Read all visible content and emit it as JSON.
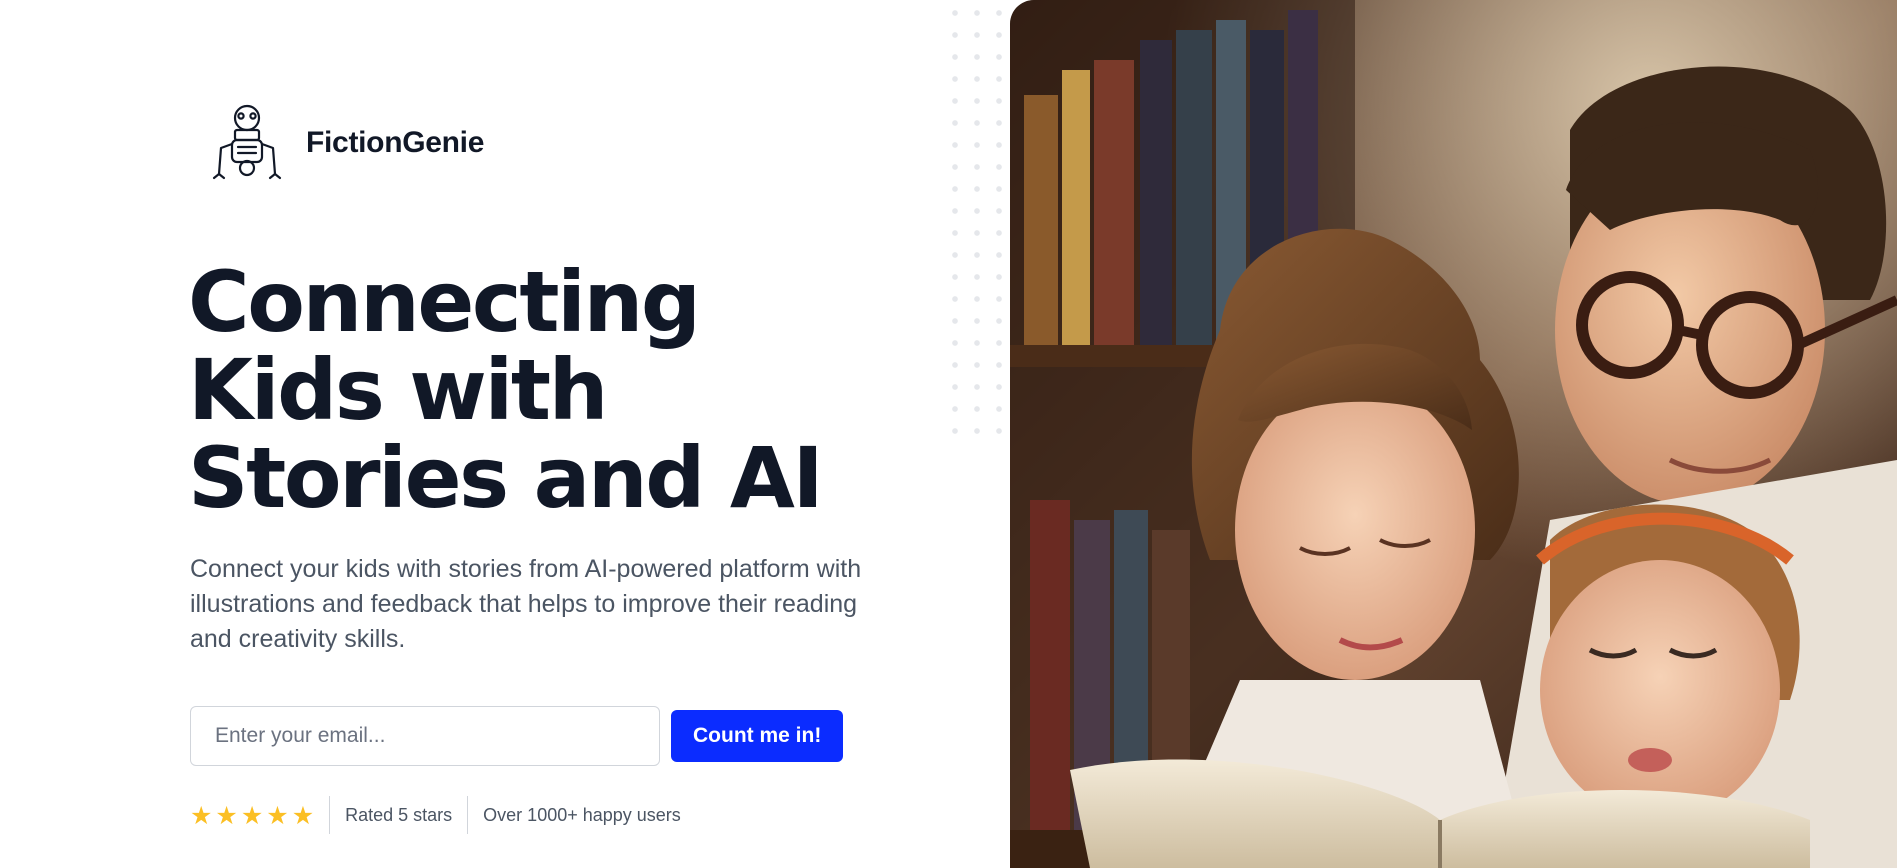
{
  "brand": {
    "name": "FictionGenie",
    "logo_icon": "robot-icon"
  },
  "hero": {
    "headline": "Connecting Kids with Stories and AI",
    "description": "Connect your kids with stories from AI-powered platform with illustrations and feedback that helps to improve their reading and creativity skills."
  },
  "signup": {
    "email_placeholder": "Enter your email...",
    "email_value": "",
    "cta_label": "Count me in!"
  },
  "social_proof": {
    "rating": 5,
    "rating_max": 5,
    "star_glyph": "★",
    "rated_text": "Rated 5 stars",
    "users_text": "Over 1000+ happy users"
  },
  "colors": {
    "accent": "#0b2cff",
    "heading": "#111827",
    "body_text": "#4b5563",
    "star": "#fbbf24"
  },
  "image": {
    "subject": "family-reading-painting"
  }
}
